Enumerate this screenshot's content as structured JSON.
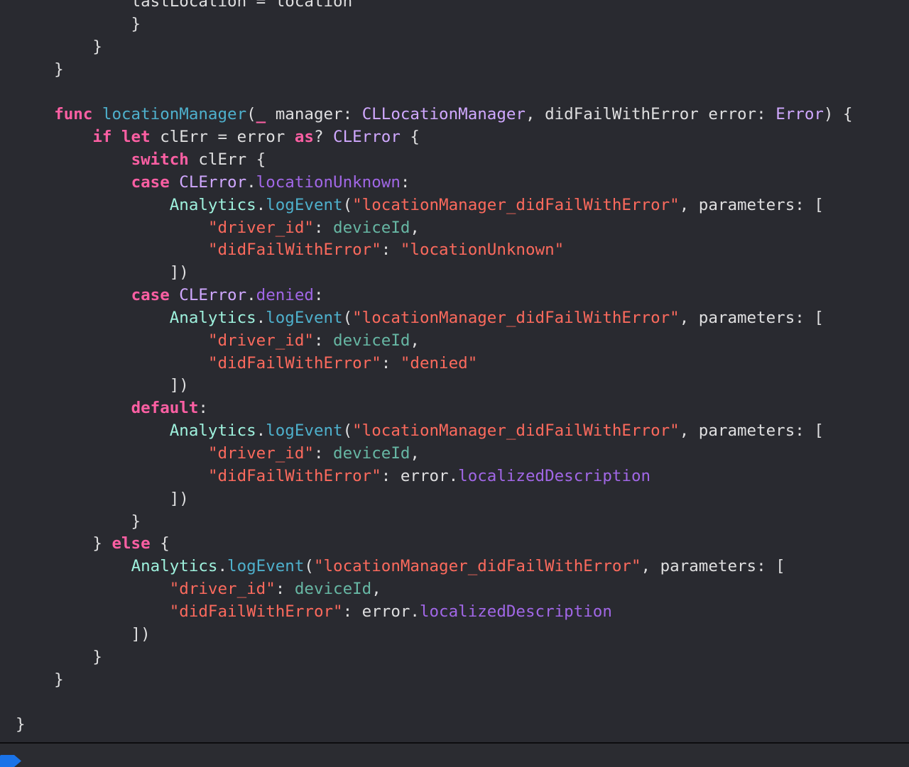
{
  "colors": {
    "background": "#292a30",
    "keyword": "#fc5fa3",
    "function": "#4eb0cc",
    "type": "#d0a8ff",
    "api_member": "#a167e6",
    "class": "#9ef1dd",
    "string": "#fc6a5d",
    "variable": "#67b7a4",
    "plain": "#dfdfe0",
    "breakpoint": "#1a73e8"
  },
  "editor": {
    "lines": [
      [
        {
          "t": "plain",
          "s": "            "
        },
        {
          "t": "plain",
          "s": "lastLocation = location"
        }
      ],
      [
        {
          "t": "plain",
          "s": "            }"
        }
      ],
      [
        {
          "t": "plain",
          "s": "        }"
        }
      ],
      [
        {
          "t": "plain",
          "s": "    }"
        }
      ],
      [],
      [
        {
          "t": "plain",
          "s": "    "
        },
        {
          "t": "kw",
          "s": "func"
        },
        {
          "t": "plain",
          "s": " "
        },
        {
          "t": "fn",
          "s": "locationManager"
        },
        {
          "t": "plain",
          "s": "("
        },
        {
          "t": "kw",
          "s": "_"
        },
        {
          "t": "plain",
          "s": " manager: "
        },
        {
          "t": "type",
          "s": "CLLocationManager"
        },
        {
          "t": "plain",
          "s": ", didFailWithError error: "
        },
        {
          "t": "type",
          "s": "Error"
        },
        {
          "t": "plain",
          "s": ") {"
        }
      ],
      [
        {
          "t": "plain",
          "s": "        "
        },
        {
          "t": "kw",
          "s": "if"
        },
        {
          "t": "plain",
          "s": " "
        },
        {
          "t": "kw",
          "s": "let"
        },
        {
          "t": "plain",
          "s": " clErr = error "
        },
        {
          "t": "kw",
          "s": "as"
        },
        {
          "t": "plain",
          "s": "? "
        },
        {
          "t": "type",
          "s": "CLError"
        },
        {
          "t": "plain",
          "s": " {"
        }
      ],
      [
        {
          "t": "plain",
          "s": "            "
        },
        {
          "t": "kw",
          "s": "switch"
        },
        {
          "t": "plain",
          "s": " clErr {"
        }
      ],
      [
        {
          "t": "plain",
          "s": "            "
        },
        {
          "t": "kw",
          "s": "case"
        },
        {
          "t": "plain",
          "s": " "
        },
        {
          "t": "type",
          "s": "CLError"
        },
        {
          "t": "plain",
          "s": "."
        },
        {
          "t": "api",
          "s": "locationUnknown"
        },
        {
          "t": "plain",
          "s": ":"
        }
      ],
      [
        {
          "t": "plain",
          "s": "                "
        },
        {
          "t": "cls",
          "s": "Analytics"
        },
        {
          "t": "plain",
          "s": "."
        },
        {
          "t": "fn",
          "s": "logEvent"
        },
        {
          "t": "plain",
          "s": "("
        },
        {
          "t": "str",
          "s": "\"locationManager_didFailWithError\""
        },
        {
          "t": "plain",
          "s": ", parameters: ["
        }
      ],
      [
        {
          "t": "plain",
          "s": "                    "
        },
        {
          "t": "str",
          "s": "\"driver_id\""
        },
        {
          "t": "plain",
          "s": ": "
        },
        {
          "t": "var",
          "s": "deviceId"
        },
        {
          "t": "plain",
          "s": ","
        }
      ],
      [
        {
          "t": "plain",
          "s": "                    "
        },
        {
          "t": "str",
          "s": "\"didFailWithError\""
        },
        {
          "t": "plain",
          "s": ": "
        },
        {
          "t": "str",
          "s": "\"locationUnknown\""
        }
      ],
      [
        {
          "t": "plain",
          "s": "                ])"
        }
      ],
      [
        {
          "t": "plain",
          "s": "            "
        },
        {
          "t": "kw",
          "s": "case"
        },
        {
          "t": "plain",
          "s": " "
        },
        {
          "t": "type",
          "s": "CLError"
        },
        {
          "t": "plain",
          "s": "."
        },
        {
          "t": "api",
          "s": "denied"
        },
        {
          "t": "plain",
          "s": ":"
        }
      ],
      [
        {
          "t": "plain",
          "s": "                "
        },
        {
          "t": "cls",
          "s": "Analytics"
        },
        {
          "t": "plain",
          "s": "."
        },
        {
          "t": "fn",
          "s": "logEvent"
        },
        {
          "t": "plain",
          "s": "("
        },
        {
          "t": "str",
          "s": "\"locationManager_didFailWithError\""
        },
        {
          "t": "plain",
          "s": ", parameters: ["
        }
      ],
      [
        {
          "t": "plain",
          "s": "                    "
        },
        {
          "t": "str",
          "s": "\"driver_id\""
        },
        {
          "t": "plain",
          "s": ": "
        },
        {
          "t": "var",
          "s": "deviceId"
        },
        {
          "t": "plain",
          "s": ","
        }
      ],
      [
        {
          "t": "plain",
          "s": "                    "
        },
        {
          "t": "str",
          "s": "\"didFailWithError\""
        },
        {
          "t": "plain",
          "s": ": "
        },
        {
          "t": "str",
          "s": "\"denied\""
        }
      ],
      [
        {
          "t": "plain",
          "s": "                ])"
        }
      ],
      [
        {
          "t": "plain",
          "s": "            "
        },
        {
          "t": "kw",
          "s": "default"
        },
        {
          "t": "plain",
          "s": ":"
        }
      ],
      [
        {
          "t": "plain",
          "s": "                "
        },
        {
          "t": "cls",
          "s": "Analytics"
        },
        {
          "t": "plain",
          "s": "."
        },
        {
          "t": "fn",
          "s": "logEvent"
        },
        {
          "t": "plain",
          "s": "("
        },
        {
          "t": "str",
          "s": "\"locationManager_didFailWithError\""
        },
        {
          "t": "plain",
          "s": ", parameters: ["
        }
      ],
      [
        {
          "t": "plain",
          "s": "                    "
        },
        {
          "t": "str",
          "s": "\"driver_id\""
        },
        {
          "t": "plain",
          "s": ": "
        },
        {
          "t": "var",
          "s": "deviceId"
        },
        {
          "t": "plain",
          "s": ","
        }
      ],
      [
        {
          "t": "plain",
          "s": "                    "
        },
        {
          "t": "str",
          "s": "\"didFailWithError\""
        },
        {
          "t": "plain",
          "s": ": error."
        },
        {
          "t": "api",
          "s": "localizedDescription"
        }
      ],
      [
        {
          "t": "plain",
          "s": "                ])"
        }
      ],
      [
        {
          "t": "plain",
          "s": "            }"
        }
      ],
      [
        {
          "t": "plain",
          "s": "        } "
        },
        {
          "t": "kw",
          "s": "else"
        },
        {
          "t": "plain",
          "s": " {"
        }
      ],
      [
        {
          "t": "plain",
          "s": "            "
        },
        {
          "t": "cls",
          "s": "Analytics"
        },
        {
          "t": "plain",
          "s": "."
        },
        {
          "t": "fn",
          "s": "logEvent"
        },
        {
          "t": "plain",
          "s": "("
        },
        {
          "t": "str",
          "s": "\"locationManager_didFailWithError\""
        },
        {
          "t": "plain",
          "s": ", parameters: ["
        }
      ],
      [
        {
          "t": "plain",
          "s": "                "
        },
        {
          "t": "str",
          "s": "\"driver_id\""
        },
        {
          "t": "plain",
          "s": ": "
        },
        {
          "t": "var",
          "s": "deviceId"
        },
        {
          "t": "plain",
          "s": ","
        }
      ],
      [
        {
          "t": "plain",
          "s": "                "
        },
        {
          "t": "str",
          "s": "\"didFailWithError\""
        },
        {
          "t": "plain",
          "s": ": error."
        },
        {
          "t": "api",
          "s": "localizedDescription"
        }
      ],
      [
        {
          "t": "plain",
          "s": "            ])"
        }
      ],
      [
        {
          "t": "plain",
          "s": "        }"
        }
      ],
      [
        {
          "t": "plain",
          "s": "    }"
        }
      ],
      [],
      [
        {
          "t": "plain",
          "s": "}"
        }
      ]
    ]
  },
  "statusbar": {
    "breakpoint_icon": "breakpoint-indicator-icon"
  }
}
